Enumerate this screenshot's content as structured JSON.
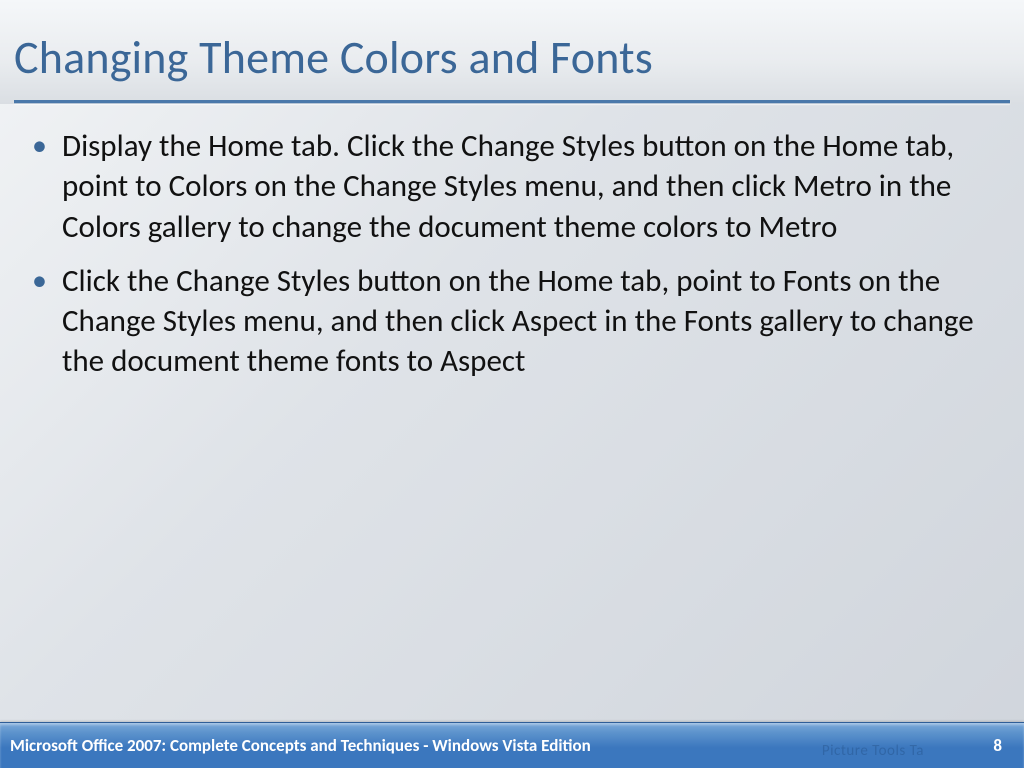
{
  "slide": {
    "title": "Changing Theme Colors and Fonts",
    "bullets": [
      "Display the Home tab. Click the Change Styles button on the Home tab, point to Colors on the Change Styles menu, and then click Metro in the Colors gallery to change the document theme colors to Metro",
      "Click the Change Styles button on the Home tab, point to Fonts on the Change Styles menu, and then click Aspect in the Fonts gallery to change the document theme fonts to Aspect"
    ]
  },
  "footer": {
    "text": "Microsoft Office 2007: Complete Concepts and Techniques - Windows Vista Edition",
    "page": "8",
    "ghost": "Picture Tools     Ta"
  }
}
